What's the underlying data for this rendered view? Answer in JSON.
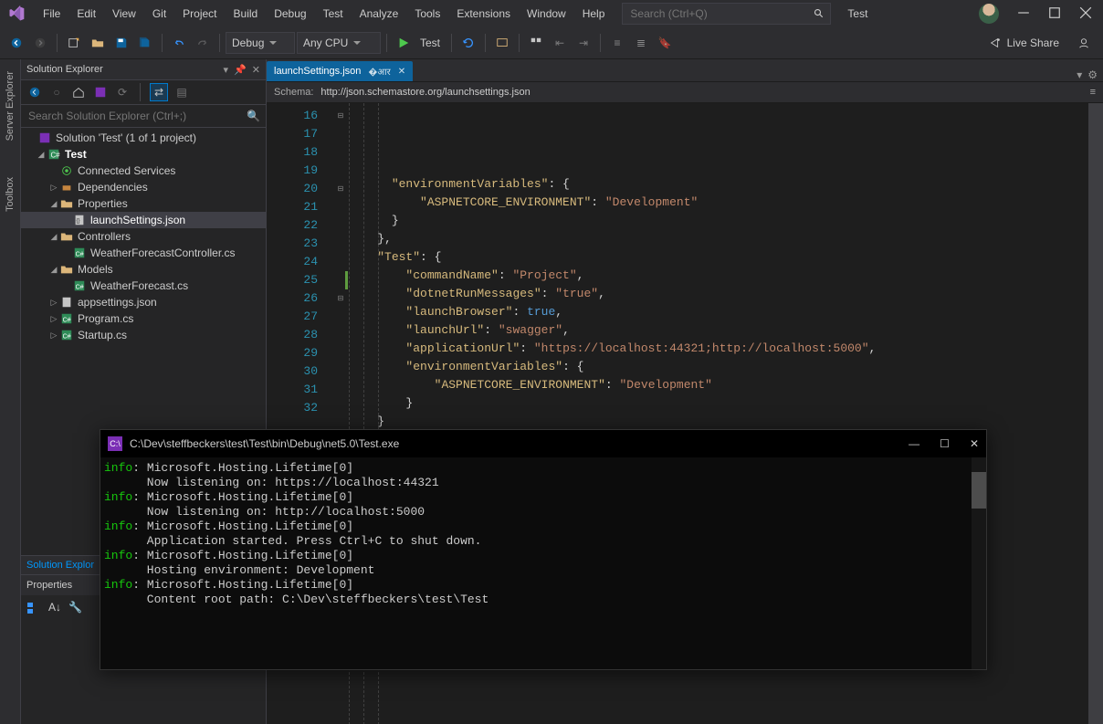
{
  "menu": [
    "File",
    "Edit",
    "View",
    "Git",
    "Project",
    "Build",
    "Debug",
    "Test",
    "Analyze",
    "Tools",
    "Extensions",
    "Window",
    "Help"
  ],
  "title_search_placeholder": "Search (Ctrl+Q)",
  "solution_name": "Test",
  "toolbar": {
    "config": "Debug",
    "platform": "Any CPU",
    "run": "Test"
  },
  "liveshare": "Live Share",
  "side_tabs": [
    "Server Explorer",
    "Toolbox"
  ],
  "se": {
    "title": "Solution Explorer",
    "search_placeholder": "Search Solution Explorer (Ctrl+;)",
    "root": "Solution 'Test' (1 of 1 project)",
    "proj": "Test",
    "items": {
      "connected": "Connected Services",
      "deps": "Dependencies",
      "props": "Properties",
      "launch": "launchSettings.json",
      "controllers": "Controllers",
      "wfc": "WeatherForecastController.cs",
      "models": "Models",
      "wf": "WeatherForecast.cs",
      "appsettings": "appsettings.json",
      "program": "Program.cs",
      "startup": "Startup.cs"
    },
    "bottom_tab": "Solution Explor",
    "props_title": "Properties"
  },
  "editor": {
    "tab": "launchSettings.json",
    "schema_label": "Schema:",
    "schema": "http://json.schemastore.org/launchsettings.json",
    "lines": {
      "16": [
        [
          "k",
          "\"environmentVariables\""
        ],
        [
          "p",
          ": {"
        ]
      ],
      "17": [
        [
          "p",
          "  "
        ],
        [
          "k",
          "\"ASPNETCORE_ENVIRONMENT\""
        ],
        [
          "p",
          ": "
        ],
        [
          "s",
          "\"Development\""
        ]
      ],
      "18": [
        [
          "p",
          "}"
        ]
      ],
      "19": [
        [
          "p",
          "},"
        ]
      ],
      "20": [
        [
          "k",
          "\"Test\""
        ],
        [
          "p",
          ": {"
        ]
      ],
      "21": [
        [
          "p",
          "  "
        ],
        [
          "k",
          "\"commandName\""
        ],
        [
          "p",
          ": "
        ],
        [
          "s",
          "\"Project\""
        ],
        [
          "p",
          ","
        ]
      ],
      "22": [
        [
          "p",
          "  "
        ],
        [
          "k",
          "\"dotnetRunMessages\""
        ],
        [
          "p",
          ": "
        ],
        [
          "s",
          "\"true\""
        ],
        [
          "p",
          ","
        ]
      ],
      "23": [
        [
          "p",
          "  "
        ],
        [
          "k",
          "\"launchBrowser\""
        ],
        [
          "p",
          ": "
        ],
        [
          "b",
          "true"
        ],
        [
          "p",
          ","
        ]
      ],
      "24": [
        [
          "p",
          "  "
        ],
        [
          "k",
          "\"launchUrl\""
        ],
        [
          "p",
          ": "
        ],
        [
          "s",
          "\"swagger\""
        ],
        [
          "p",
          ","
        ]
      ],
      "25": [
        [
          "p",
          "  "
        ],
        [
          "k",
          "\"applicationUrl\""
        ],
        [
          "p",
          ": "
        ],
        [
          "s",
          "\"https://localhost:44321;http://localhost:5000\""
        ],
        [
          "p",
          ","
        ]
      ],
      "26": [
        [
          "p",
          "  "
        ],
        [
          "k",
          "\"environmentVariables\""
        ],
        [
          "p",
          ": {"
        ]
      ],
      "27": [
        [
          "p",
          "    "
        ],
        [
          "k",
          "\"ASPNETCORE_ENVIRONMENT\""
        ],
        [
          "p",
          ": "
        ],
        [
          "s",
          "\"Development\""
        ]
      ],
      "28": [
        [
          "p",
          "  }"
        ]
      ],
      "29": [
        [
          "p",
          "}"
        ]
      ],
      "30": [
        [
          "p",
          "}"
        ]
      ],
      "31": [
        [
          "p",
          "}"
        ]
      ],
      "32": [
        [
          "p",
          ""
        ]
      ]
    },
    "indents": {
      "16": 3,
      "17": 4,
      "18": 3,
      "19": 2,
      "20": 2,
      "21": 3,
      "22": 3,
      "23": 3,
      "24": 3,
      "25": 3,
      "26": 3,
      "27": 4,
      "28": 3,
      "29": 2,
      "30": 1,
      "31": 0,
      "32": 0
    },
    "fold": {
      "16": "⊟",
      "20": "⊟",
      "26": "⊟"
    }
  },
  "console": {
    "title": "C:\\Dev\\steffbeckers\\test\\Test\\bin\\Debug\\net5.0\\Test.exe",
    "lines": [
      {
        "p": "info",
        "t": ": Microsoft.Hosting.Lifetime[0]"
      },
      {
        "p": "",
        "t": "      Now listening on: https://localhost:44321"
      },
      {
        "p": "info",
        "t": ": Microsoft.Hosting.Lifetime[0]"
      },
      {
        "p": "",
        "t": "      Now listening on: http://localhost:5000"
      },
      {
        "p": "info",
        "t": ": Microsoft.Hosting.Lifetime[0]"
      },
      {
        "p": "",
        "t": "      Application started. Press Ctrl+C to shut down."
      },
      {
        "p": "info",
        "t": ": Microsoft.Hosting.Lifetime[0]"
      },
      {
        "p": "",
        "t": "      Hosting environment: Development"
      },
      {
        "p": "info",
        "t": ": Microsoft.Hosting.Lifetime[0]"
      },
      {
        "p": "",
        "t": "      Content root path: C:\\Dev\\steffbeckers\\test\\Test"
      }
    ]
  }
}
